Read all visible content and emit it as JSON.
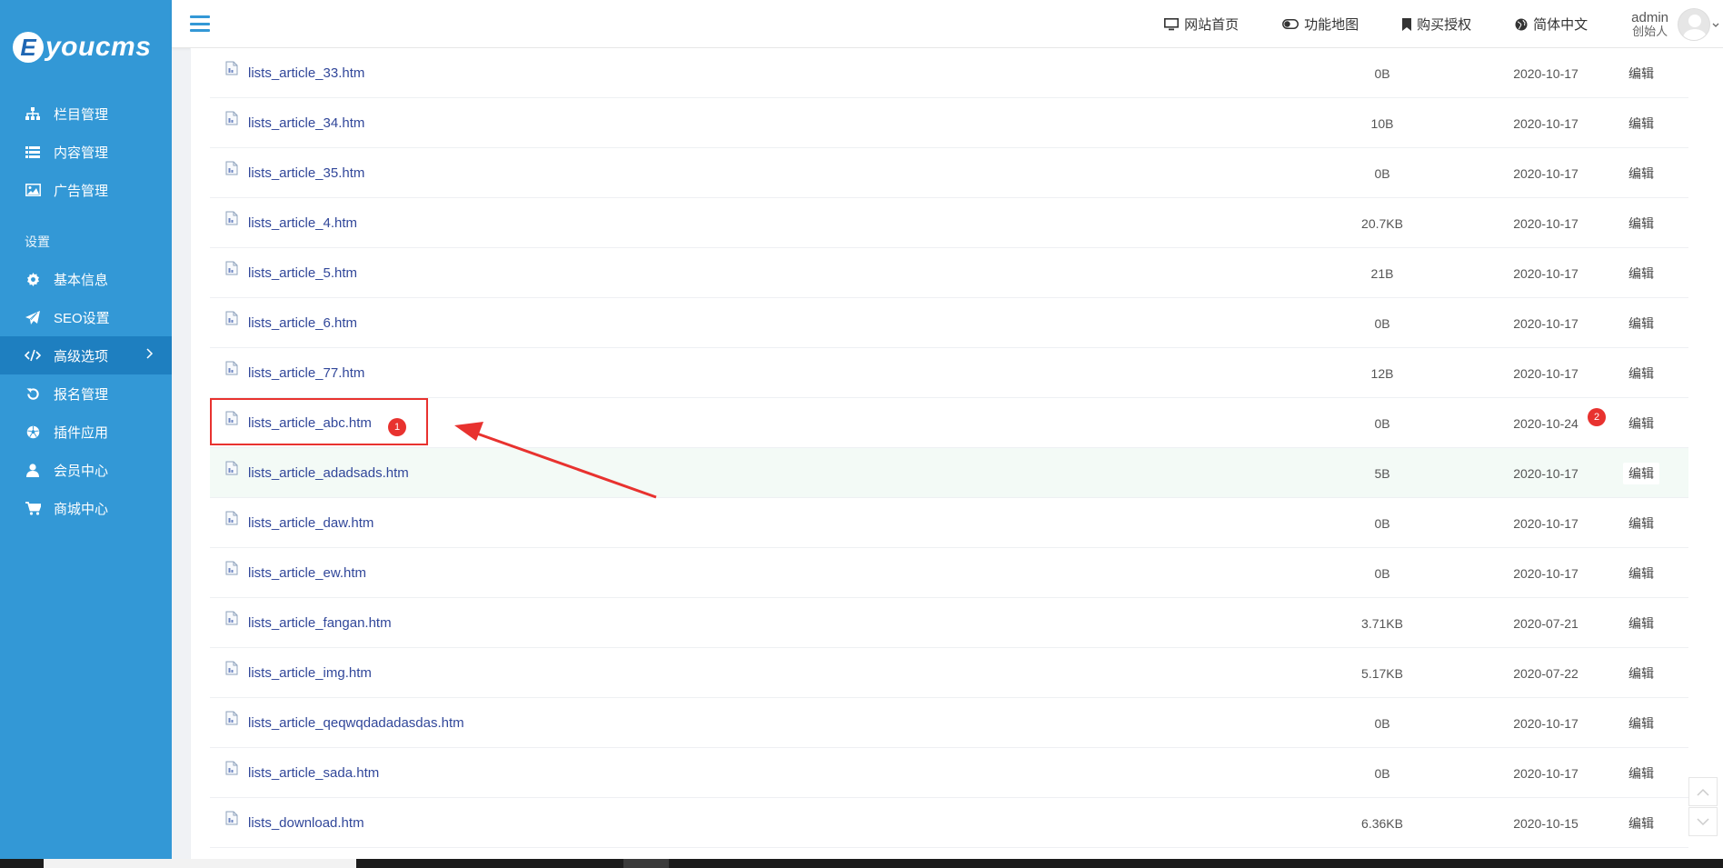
{
  "logo": {
    "letter": "E",
    "text": "youcms"
  },
  "sidebar": {
    "items_top": [
      {
        "label": "栏目管理",
        "icon": "sitemap-icon"
      },
      {
        "label": "内容管理",
        "icon": "list-icon"
      },
      {
        "label": "广告管理",
        "icon": "image-icon"
      }
    ],
    "section_label": "设置",
    "items_bottom": [
      {
        "label": "基本信息",
        "icon": "gear-icon"
      },
      {
        "label": "SEO设置",
        "icon": "paper-plane-icon"
      },
      {
        "label": "高级选项",
        "icon": "code-icon",
        "active": true
      },
      {
        "label": "报名管理",
        "icon": "refresh-icon"
      },
      {
        "label": "插件应用",
        "icon": "soccer-ball-icon"
      },
      {
        "label": "会员中心",
        "icon": "user-icon"
      },
      {
        "label": "商城中心",
        "icon": "cart-icon"
      }
    ]
  },
  "topbar": {
    "links": [
      {
        "label": "网站首页",
        "icon": "monitor-icon"
      },
      {
        "label": "功能地图",
        "icon": "toggle-icon"
      },
      {
        "label": "购买授权",
        "icon": "bookmark-icon"
      },
      {
        "label": "简体中文",
        "icon": "globe-icon"
      }
    ],
    "user": {
      "name": "admin",
      "role": "创始人"
    }
  },
  "files": [
    {
      "name": "lists_article_33.htm",
      "size": "0B",
      "date": "2020-10-17",
      "action": "编辑"
    },
    {
      "name": "lists_article_34.htm",
      "size": "10B",
      "date": "2020-10-17",
      "action": "编辑"
    },
    {
      "name": "lists_article_35.htm",
      "size": "0B",
      "date": "2020-10-17",
      "action": "编辑"
    },
    {
      "name": "lists_article_4.htm",
      "size": "20.7KB",
      "date": "2020-10-17",
      "action": "编辑"
    },
    {
      "name": "lists_article_5.htm",
      "size": "21B",
      "date": "2020-10-17",
      "action": "编辑"
    },
    {
      "name": "lists_article_6.htm",
      "size": "0B",
      "date": "2020-10-17",
      "action": "编辑"
    },
    {
      "name": "lists_article_77.htm",
      "size": "12B",
      "date": "2020-10-17",
      "action": "编辑"
    },
    {
      "name": "lists_article_abc.htm",
      "size": "0B",
      "date": "2020-10-24",
      "action": "编辑"
    },
    {
      "name": "lists_article_adadsads.htm",
      "size": "5B",
      "date": "2020-10-17",
      "action": "编辑"
    },
    {
      "name": "lists_article_daw.htm",
      "size": "0B",
      "date": "2020-10-17",
      "action": "编辑"
    },
    {
      "name": "lists_article_ew.htm",
      "size": "0B",
      "date": "2020-10-17",
      "action": "编辑"
    },
    {
      "name": "lists_article_fangan.htm",
      "size": "3.71KB",
      "date": "2020-07-21",
      "action": "编辑"
    },
    {
      "name": "lists_article_img.htm",
      "size": "5.17KB",
      "date": "2020-07-22",
      "action": "编辑"
    },
    {
      "name": "lists_article_qeqwqdadadasdas.htm",
      "size": "0B",
      "date": "2020-10-17",
      "action": "编辑"
    },
    {
      "name": "lists_article_sada.htm",
      "size": "0B",
      "date": "2020-10-17",
      "action": "编辑"
    },
    {
      "name": "lists_download.htm",
      "size": "6.36KB",
      "date": "2020-10-15",
      "action": "编辑"
    }
  ],
  "annotations": {
    "badge1": "1",
    "badge2": "2",
    "color": "#e8322f"
  },
  "colors": {
    "sidebar": "#3398d6",
    "sidebar_active": "#1e7fc0",
    "link": "#31479a"
  }
}
